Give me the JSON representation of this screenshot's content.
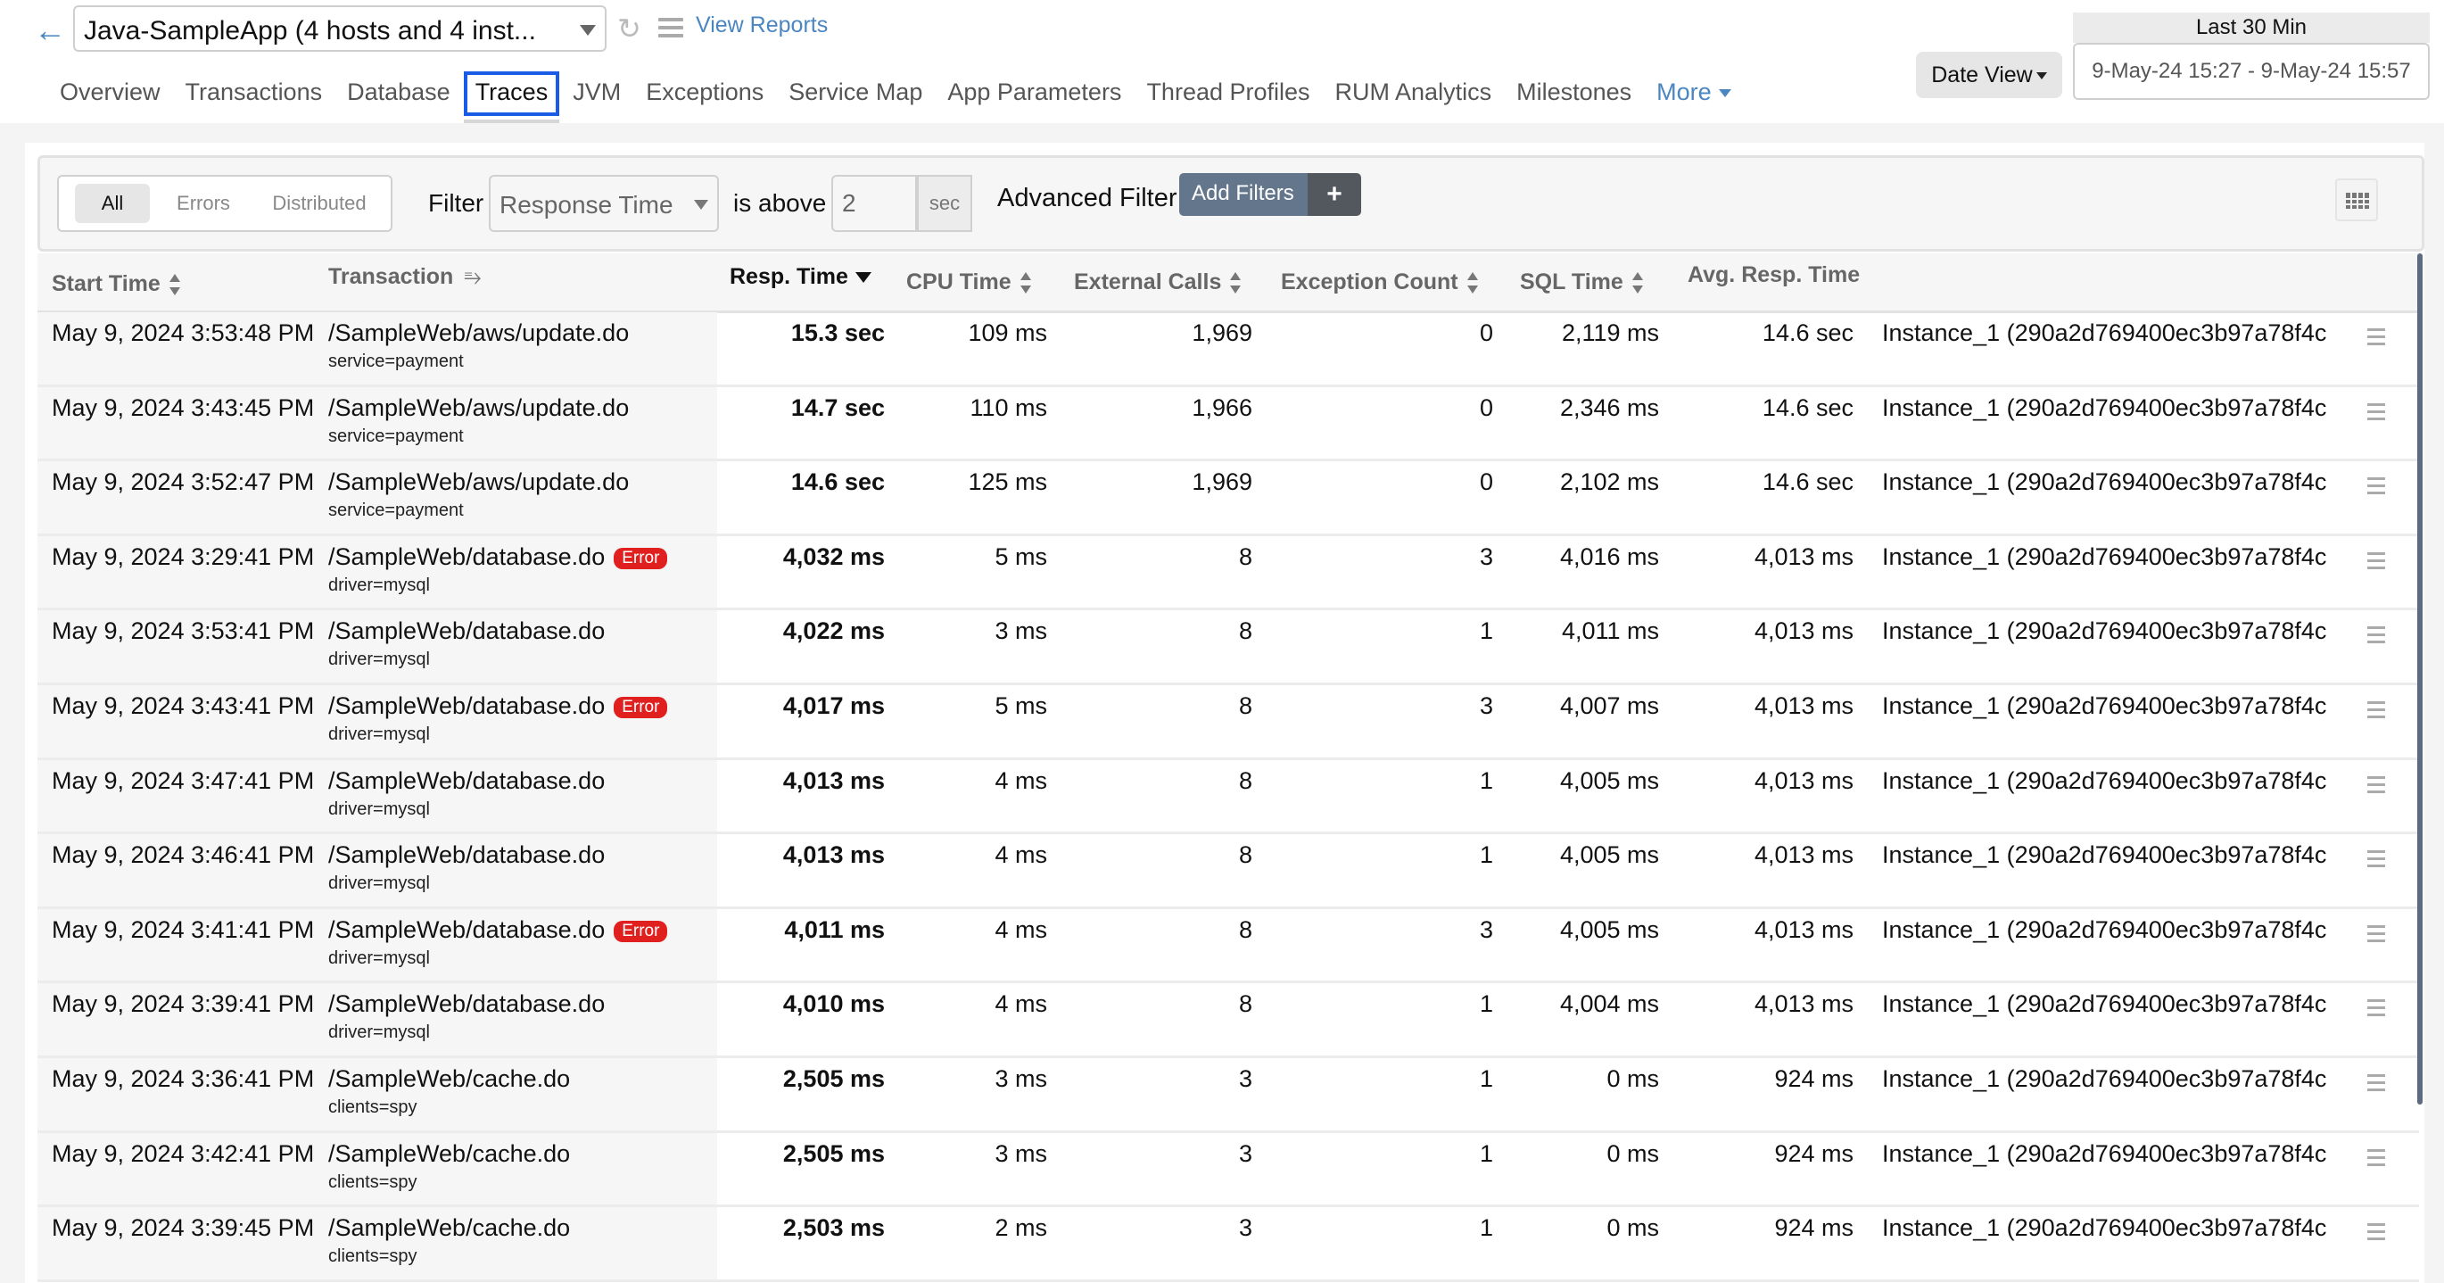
{
  "header": {
    "app_name": "Java-SampleApp (4 hosts and 4 inst...",
    "view_reports": "View Reports",
    "date_view": "Date View",
    "range_preset": "Last 30 Min",
    "date_range": "9-May-24 15:27 - 9-May-24 15:57"
  },
  "tabs": [
    {
      "label": "Overview",
      "active": false
    },
    {
      "label": "Transactions",
      "active": false
    },
    {
      "label": "Database",
      "active": false
    },
    {
      "label": "Traces",
      "active": true
    },
    {
      "label": "JVM",
      "active": false
    },
    {
      "label": "Exceptions",
      "active": false
    },
    {
      "label": "Service Map",
      "active": false
    },
    {
      "label": "App Parameters",
      "active": false
    },
    {
      "label": "Thread Profiles",
      "active": false
    },
    {
      "label": "RUM Analytics",
      "active": false
    },
    {
      "label": "Milestones",
      "active": false
    },
    {
      "label": "More",
      "active": false
    }
  ],
  "filter": {
    "segments": [
      "All",
      "Errors",
      "Distributed"
    ],
    "active_segment": "All",
    "filter_label": "Filter",
    "metric": "Response Time",
    "condition": "is above",
    "threshold": "2",
    "unit": "sec",
    "advanced_label": "Advanced Filter",
    "add_filters": "Add Filters",
    "add_plus": "+"
  },
  "table": {
    "columns": [
      "Start Time",
      "Transaction",
      "Resp. Time",
      "CPU Time",
      "External Calls",
      "Exception Count",
      "SQL Time",
      "Avg. Resp. Time"
    ],
    "error_badge": "Error",
    "rows": [
      {
        "start": "May 9, 2024 3:53:48 PM",
        "txn": "/SampleWeb/aws/update.do",
        "param": "service=payment",
        "error": false,
        "resp": "15.3 sec",
        "cpu": "109 ms",
        "ext": "1,969",
        "exc": "0",
        "sql": "2,119 ms",
        "avg": "14.6 sec",
        "instance": "Instance_1 (290a2d769400ec3b97a78f4c"
      },
      {
        "start": "May 9, 2024 3:43:45 PM",
        "txn": "/SampleWeb/aws/update.do",
        "param": "service=payment",
        "error": false,
        "resp": "14.7 sec",
        "cpu": "110 ms",
        "ext": "1,966",
        "exc": "0",
        "sql": "2,346 ms",
        "avg": "14.6 sec",
        "instance": "Instance_1 (290a2d769400ec3b97a78f4c"
      },
      {
        "start": "May 9, 2024 3:52:47 PM",
        "txn": "/SampleWeb/aws/update.do",
        "param": "service=payment",
        "error": false,
        "resp": "14.6 sec",
        "cpu": "125 ms",
        "ext": "1,969",
        "exc": "0",
        "sql": "2,102 ms",
        "avg": "14.6 sec",
        "instance": "Instance_1 (290a2d769400ec3b97a78f4c"
      },
      {
        "start": "May 9, 2024 3:29:41 PM",
        "txn": "/SampleWeb/database.do",
        "param": "driver=mysql",
        "error": true,
        "resp": "4,032 ms",
        "cpu": "5 ms",
        "ext": "8",
        "exc": "3",
        "sql": "4,016 ms",
        "avg": "4,013 ms",
        "instance": "Instance_1 (290a2d769400ec3b97a78f4c"
      },
      {
        "start": "May 9, 2024 3:53:41 PM",
        "txn": "/SampleWeb/database.do",
        "param": "driver=mysql",
        "error": false,
        "resp": "4,022 ms",
        "cpu": "3 ms",
        "ext": "8",
        "exc": "1",
        "sql": "4,011 ms",
        "avg": "4,013 ms",
        "instance": "Instance_1 (290a2d769400ec3b97a78f4c"
      },
      {
        "start": "May 9, 2024 3:43:41 PM",
        "txn": "/SampleWeb/database.do",
        "param": "driver=mysql",
        "error": true,
        "resp": "4,017 ms",
        "cpu": "5 ms",
        "ext": "8",
        "exc": "3",
        "sql": "4,007 ms",
        "avg": "4,013 ms",
        "instance": "Instance_1 (290a2d769400ec3b97a78f4c"
      },
      {
        "start": "May 9, 2024 3:47:41 PM",
        "txn": "/SampleWeb/database.do",
        "param": "driver=mysql",
        "error": false,
        "resp": "4,013 ms",
        "cpu": "4 ms",
        "ext": "8",
        "exc": "1",
        "sql": "4,005 ms",
        "avg": "4,013 ms",
        "instance": "Instance_1 (290a2d769400ec3b97a78f4c"
      },
      {
        "start": "May 9, 2024 3:46:41 PM",
        "txn": "/SampleWeb/database.do",
        "param": "driver=mysql",
        "error": false,
        "resp": "4,013 ms",
        "cpu": "4 ms",
        "ext": "8",
        "exc": "1",
        "sql": "4,005 ms",
        "avg": "4,013 ms",
        "instance": "Instance_1 (290a2d769400ec3b97a78f4c"
      },
      {
        "start": "May 9, 2024 3:41:41 PM",
        "txn": "/SampleWeb/database.do",
        "param": "driver=mysql",
        "error": true,
        "resp": "4,011 ms",
        "cpu": "4 ms",
        "ext": "8",
        "exc": "3",
        "sql": "4,005 ms",
        "avg": "4,013 ms",
        "instance": "Instance_1 (290a2d769400ec3b97a78f4c"
      },
      {
        "start": "May 9, 2024 3:39:41 PM",
        "txn": "/SampleWeb/database.do",
        "param": "driver=mysql",
        "error": false,
        "resp": "4,010 ms",
        "cpu": "4 ms",
        "ext": "8",
        "exc": "1",
        "sql": "4,004 ms",
        "avg": "4,013 ms",
        "instance": "Instance_1 (290a2d769400ec3b97a78f4c"
      },
      {
        "start": "May 9, 2024 3:36:41 PM",
        "txn": "/SampleWeb/cache.do",
        "param": "clients=spy",
        "error": false,
        "resp": "2,505 ms",
        "cpu": "3 ms",
        "ext": "3",
        "exc": "1",
        "sql": "0 ms",
        "avg": "924 ms",
        "instance": "Instance_1 (290a2d769400ec3b97a78f4c"
      },
      {
        "start": "May 9, 2024 3:42:41 PM",
        "txn": "/SampleWeb/cache.do",
        "param": "clients=spy",
        "error": false,
        "resp": "2,505 ms",
        "cpu": "3 ms",
        "ext": "3",
        "exc": "1",
        "sql": "0 ms",
        "avg": "924 ms",
        "instance": "Instance_1 (290a2d769400ec3b97a78f4c"
      },
      {
        "start": "May 9, 2024 3:39:45 PM",
        "txn": "/SampleWeb/cache.do",
        "param": "clients=spy",
        "error": false,
        "resp": "2,503 ms",
        "cpu": "2 ms",
        "ext": "3",
        "exc": "1",
        "sql": "0 ms",
        "avg": "924 ms",
        "instance": "Instance_1 (290a2d769400ec3b97a78f4c"
      }
    ]
  },
  "icons": {
    "back": "arrow-left-icon",
    "refresh": "refresh-icon",
    "menu": "hamburger-menu-icon",
    "columns": "column-chooser-icon",
    "row_menu": "row-menu-icon"
  },
  "colors": {
    "accent": "#1a5ce6",
    "link": "#4a86c0",
    "error": "#e0201e",
    "button": "#64768c"
  }
}
